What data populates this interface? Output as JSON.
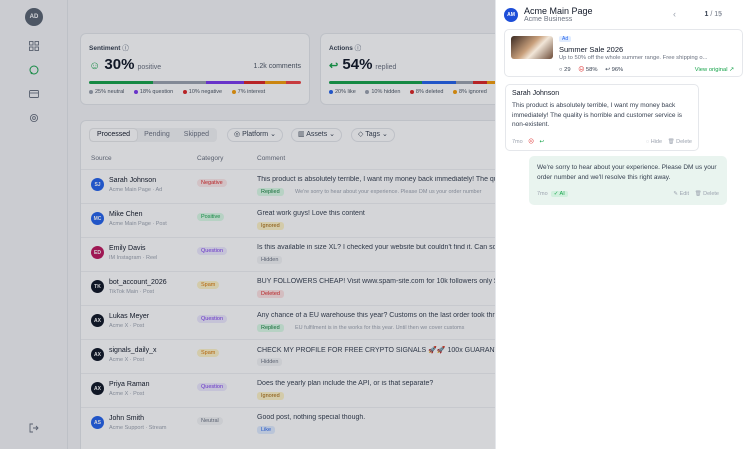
{
  "user": {
    "initials": "AD"
  },
  "rail": {
    "icons": [
      "grid-icon",
      "chat-icon",
      "inbox-icon",
      "settings-icon",
      "logout-icon"
    ]
  },
  "sentiment": {
    "title": "Sentiment",
    "value": "30%",
    "value_label": "positive",
    "count": "1.2k comments",
    "legend": [
      "25% neutral",
      "18% question",
      "10% negative",
      "7% interest"
    ]
  },
  "actions": {
    "title": "Actions",
    "value": "54%",
    "value_label": "replied",
    "legend": [
      "20% like",
      "10% hidden",
      "8% deleted",
      "8% ignored"
    ]
  },
  "tabs": [
    "Processed",
    "Pending",
    "Skipped"
  ],
  "filters": [
    "Platform",
    "Assets",
    "Tags"
  ],
  "columns": {
    "source": "Source",
    "category": "Category",
    "comment": "Comment"
  },
  "rows": [
    {
      "initials": "SJ",
      "color": "#2563eb",
      "name": "Sarah Johnson",
      "sub": "Acme Main Page · Ad",
      "category": "Negative",
      "cat_class": "neg",
      "comment": "This product is absolutely terrible, I want my money back immediately! The quality is horrible",
      "status": "Replied",
      "status_class": "s-rep",
      "reply": "We're sorry to hear about your experience. Please DM us your order number"
    },
    {
      "initials": "MC",
      "color": "#2563eb",
      "name": "Mike Chen",
      "sub": "Acme Main Page · Post",
      "category": "Positive",
      "cat_class": "pos",
      "comment": "Great work guys! Love this content",
      "status": "Ignored",
      "status_class": "s-ign",
      "reply": ""
    },
    {
      "initials": "ED",
      "color": "#be185d",
      "name": "Emily Davis",
      "sub": "IM Instagram · Reel",
      "category": "Question",
      "cat_class": "que",
      "comment": "Is this available in size XL? I checked your website but couldn't find it. Can someone help?",
      "status": "Hidden",
      "status_class": "s-hid",
      "reply": ""
    },
    {
      "initials": "TK",
      "color": "#111827",
      "name": "bot_account_2026",
      "sub": "TikTok Main · Post",
      "category": "Spam",
      "cat_class": "spam",
      "comment": "BUY FOLLOWERS CHEAP! Visit www.spam-site.com for 10k followers only $5!!!",
      "status": "Deleted",
      "status_class": "s-del",
      "reply": ""
    },
    {
      "initials": "AX",
      "color": "#111827",
      "name": "Lukas Meyer",
      "sub": "Acme X · Post",
      "category": "Question",
      "cat_class": "que",
      "comment": "Any chance of a EU warehouse this year? Customs on the last order took three weeks",
      "status": "Replied",
      "status_class": "s-rep",
      "reply": "EU fulfilment is in the works for this year. Until then we cover customs"
    },
    {
      "initials": "AX",
      "color": "#111827",
      "name": "signals_daily_x",
      "sub": "Acme X · Post",
      "category": "Spam",
      "cat_class": "spam",
      "comment": "CHECK MY PROFILE FOR FREE CRYPTO SIGNALS 🚀🚀 100x GUARANTEED",
      "status": "Hidden",
      "status_class": "s-hid",
      "reply": ""
    },
    {
      "initials": "AX",
      "color": "#111827",
      "name": "Priya Raman",
      "sub": "Acme X · Post",
      "category": "Question",
      "cat_class": "que",
      "comment": "Does the yearly plan include the API, or is that separate?",
      "status": "Ignored",
      "status_class": "s-ign",
      "reply": ""
    },
    {
      "initials": "AS",
      "color": "#2563eb",
      "name": "John Smith",
      "sub": "Acme Support · Stream",
      "category": "Neutral",
      "cat_class": "neu",
      "comment": "Good post, nothing special though.",
      "status": "Like",
      "status_class": "s-like",
      "reply": ""
    }
  ],
  "panel": {
    "initials": "AM",
    "title": "Acme Main Page",
    "subtitle": "Acme Business",
    "nav_current": "1",
    "nav_total": "/ 15",
    "post": {
      "badge": "Ad",
      "title": "Summer Sale 2026",
      "desc": "Up to 50% off the whole summer range. Free shipping o...",
      "comments": "29",
      "negative": "58%",
      "replied": "96%",
      "view_label": "View original"
    },
    "comment": {
      "author": "Sarah Johnson",
      "text": "This product is absolutely terrible, I want my money back immediately! The quality is horrible and customer service is non-existent.",
      "time": "7mo",
      "hide": "Hide",
      "delete": "Delete"
    },
    "reply": {
      "text": "We're sorry to hear about your experience. Please DM us your order number and we'll resolve this right away.",
      "time": "7mo",
      "ai": "AI",
      "edit": "Edit",
      "delete": "Delete"
    }
  }
}
